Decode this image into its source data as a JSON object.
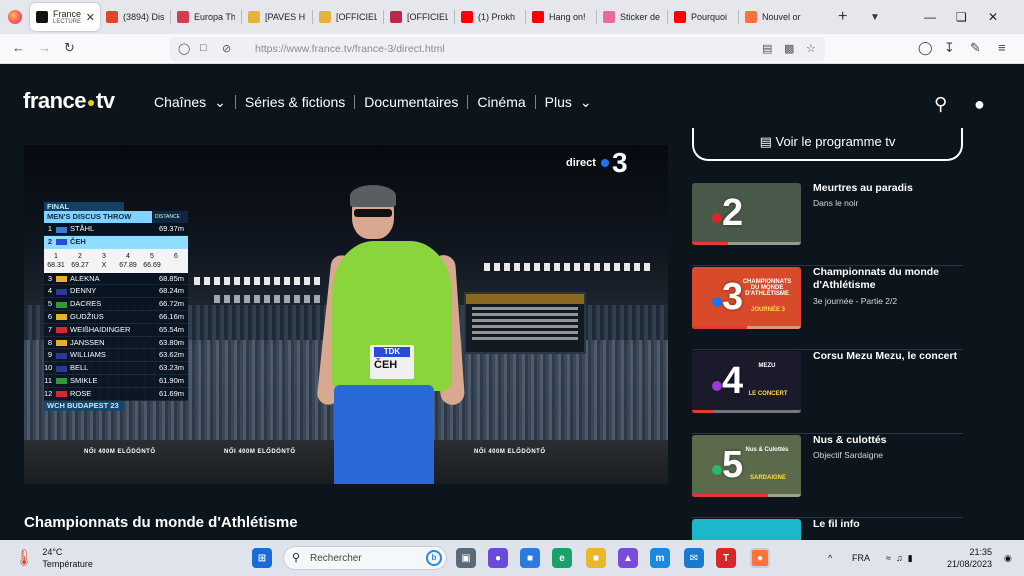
{
  "browser": {
    "tabs": [
      {
        "title": "France",
        "subtitle": "LECTURE",
        "icon": "francetv-favicon",
        "color": "#111111",
        "active": true
      },
      {
        "title": "(3894) Dis",
        "icon": "dis-favicon",
        "color": "#e0452a"
      },
      {
        "title": "Europa Th",
        "icon": "europa-favicon",
        "color": "#d83a50"
      },
      {
        "title": "[PAVES HI",
        "icon": "emoji-favicon",
        "color": "#e8b23a"
      },
      {
        "title": "[OFFICIEL",
        "icon": "emoji-favicon",
        "color": "#e8b23a"
      },
      {
        "title": "[OFFICIEL",
        "icon": "j-favicon",
        "color": "#c0264b"
      },
      {
        "title": "(1) Prokh",
        "icon": "youtube-favicon",
        "color": "#ff0000"
      },
      {
        "title": "Hang on!",
        "icon": "youtube-favicon",
        "color": "#ff0000"
      },
      {
        "title": "Sticker de",
        "icon": "sticker-favicon",
        "color": "#e86aa0"
      },
      {
        "title": "Pourquoi",
        "icon": "youtube-favicon",
        "color": "#ff0000"
      },
      {
        "title": "Nouvel or",
        "icon": "firefox-favicon",
        "color": "#ff7139"
      }
    ],
    "url": "https://www.france.tv/france-3/direct.html"
  },
  "site": {
    "logo": "france",
    "logo_suffix": "tv",
    "nav": [
      {
        "label": "Chaînes",
        "dropdown": true
      },
      {
        "label": "Séries & fictions",
        "dropdown": false
      },
      {
        "label": "Documentaires",
        "dropdown": false
      },
      {
        "label": "Cinéma",
        "dropdown": false
      },
      {
        "label": "Plus",
        "dropdown": true
      }
    ]
  },
  "player": {
    "direct_label": "direct",
    "channel_number": "3",
    "ad_text": "NŐI 400M ELŐDÖNTŐ",
    "bib_sponsor": "TDK",
    "bib_name": "ČEH",
    "results": {
      "round": "FINAL",
      "event": "MEN'S DISCUS THROW",
      "distance_label": "DISTANCE",
      "footer": "WCH BUDAPEST 23",
      "attempt_numbers": [
        "1",
        "2",
        "3",
        "4",
        "5",
        "6"
      ],
      "attempt_values": [
        "68.31",
        "69.27",
        "X",
        "67.89",
        "66.69",
        ""
      ],
      "rows": [
        {
          "rank": "1",
          "name": "STÅHL",
          "distance": "69.37m",
          "flag": "#3a7ad8"
        },
        {
          "rank": "2",
          "name": "ČEH",
          "distance": "",
          "flag": "#2a4ad8",
          "highlight": true
        },
        {
          "rank": "3",
          "name": "ALEKNA",
          "distance": "68.85m",
          "flag": "#e8b02a"
        },
        {
          "rank": "4",
          "name": "DENNY",
          "distance": "68.24m",
          "flag": "#2a3a9a"
        },
        {
          "rank": "5",
          "name": "DACRES",
          "distance": "66.72m",
          "flag": "#2a9a3a"
        },
        {
          "rank": "6",
          "name": "GUDŽIUS",
          "distance": "66.16m",
          "flag": "#e8b02a"
        },
        {
          "rank": "7",
          "name": "WEIßHAIDINGER",
          "distance": "65.54m",
          "flag": "#d8262a"
        },
        {
          "rank": "8",
          "name": "JANSSEN",
          "distance": "63.80m",
          "flag": "#e8b02a"
        },
        {
          "rank": "9",
          "name": "WILLIAMS",
          "distance": "63.62m",
          "flag": "#2a3a9a"
        },
        {
          "rank": "10",
          "name": "BELL",
          "distance": "63.23m",
          "flag": "#2a3a9a"
        },
        {
          "rank": "11",
          "name": "SMIKLE",
          "distance": "61.90m",
          "flag": "#2a9a3a"
        },
        {
          "rank": "12",
          "name": "ROSE",
          "distance": "61.69m",
          "flag": "#d8262a"
        }
      ]
    }
  },
  "video_title": "Championnats du monde d'Athlétisme",
  "program_button": "Voir le programme tv",
  "channels": [
    {
      "number": "2",
      "title": "Meurtres au paradis",
      "subtitle": "Dans le noir",
      "dot": "#d8262a",
      "bg": "#4a5a4a",
      "progress": 0.33
    },
    {
      "number": "3",
      "title": "Championnats du monde d'Athlétisme",
      "subtitle": "3e journée - Partie 2/2",
      "dot": "#1e72f0",
      "bg": "#d84a2a",
      "progress": 0.5,
      "thumb_text": "CHAMPIONNATS DU MONDE D'ATHLÉTISME",
      "thumb_sub": "JOURNÉE 3"
    },
    {
      "number": "4",
      "title": "Corsu Mezu Mezu, le concert",
      "subtitle": "",
      "dot": "#9a3ad8",
      "bg": "#1a1a2a",
      "progress": 0.2,
      "thumb_text": "MEZU",
      "thumb_sub": "LE CONCERT"
    },
    {
      "number": "5",
      "title": "Nus & culottés",
      "subtitle": "Objectif Sardaigne",
      "dot": "#2ab86a",
      "bg": "#5a6a4a",
      "progress": 0.7,
      "thumb_text": "Nus & Culottés",
      "thumb_sub": "SARDAIGNE"
    },
    {
      "number": "",
      "title": "Le fil info",
      "subtitle": "",
      "dot": "#1ab8c8",
      "bg": "#1ab8c8",
      "progress": 0
    }
  ],
  "taskbar": {
    "temperature": "24°C",
    "weather_label": "Température",
    "search_placeholder": "Rechercher",
    "language": "FRA",
    "time": "21:35",
    "date": "21/08/2023"
  }
}
